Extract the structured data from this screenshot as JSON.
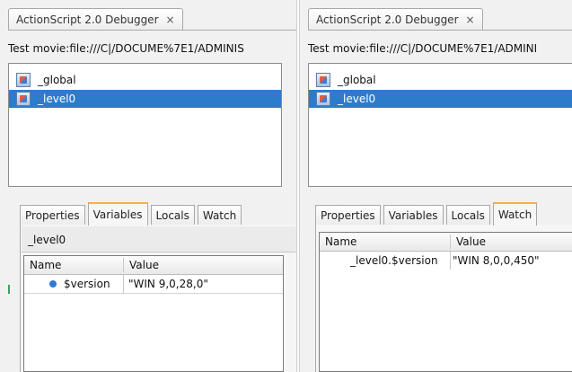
{
  "left_panel": {
    "tab_title": "ActionScript 2.0 Debugger",
    "tab_close": "×",
    "movie_path": "Test movie:file:///C|/DOCUME%7E1/ADMINIS",
    "tree": [
      {
        "label": "_global",
        "selected": false
      },
      {
        "label": "_level0",
        "selected": true
      }
    ],
    "bottom_tabs": [
      "Properties",
      "Variables",
      "Locals",
      "Watch"
    ],
    "active_tab": "Variables",
    "scope_label": "_level0",
    "grid": {
      "columns": [
        "Name",
        "Value"
      ],
      "rows": [
        {
          "name": "$version",
          "value": "\"WIN 9,0,28,0\""
        }
      ]
    }
  },
  "right_panel": {
    "tab_title": "ActionScript 2.0 Debugger",
    "tab_close": "×",
    "movie_path": "Test movie:file:///C|/DOCUME%7E1/ADMINI",
    "tree": [
      {
        "label": "_global",
        "selected": false
      },
      {
        "label": "_level0",
        "selected": true
      }
    ],
    "bottom_tabs": [
      "Properties",
      "Variables",
      "Locals",
      "Watch"
    ],
    "active_tab": "Watch",
    "grid": {
      "columns": [
        "Name",
        "Value"
      ],
      "rows": [
        {
          "name": "_level0.$version",
          "value": "\"WIN 8,0,0,450\""
        }
      ]
    }
  },
  "colors": {
    "selection": "#2d7ccc",
    "active_tab_accent": "#f2b34a",
    "variable_dot": "#2f7ad0"
  }
}
